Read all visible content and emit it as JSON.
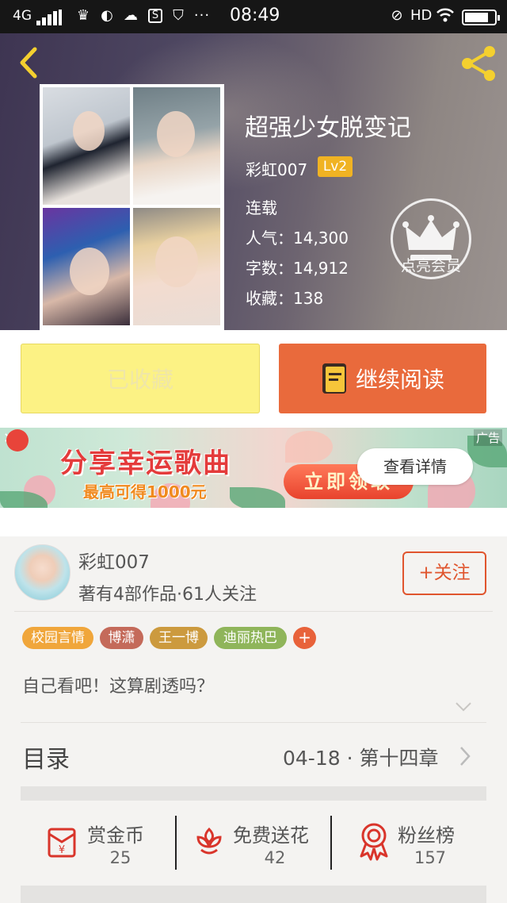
{
  "status_bar": {
    "network": "4G",
    "time": "08:49",
    "hd": "HD"
  },
  "book": {
    "title": "超强少女脱变记",
    "author": "彩虹007",
    "level": "Lv2",
    "status": "连载",
    "popularity_label": "人气：14,300",
    "words_label": "字数：14,912",
    "favorites_label": "收藏：138"
  },
  "vip": {
    "label": "点亮会员"
  },
  "actions": {
    "collected_label": "已收藏",
    "continue_label": "继续阅读"
  },
  "ad": {
    "title": "分享幸运歌曲",
    "subtitle": "最高可得1000元",
    "claim": "立即领取",
    "detail": "查看详情",
    "ad_tag": "广告",
    "close": "✕"
  },
  "author_card": {
    "name": "彩虹007",
    "stats": "著有4部作品·61人关注",
    "follow_label": "+关注"
  },
  "tags": [
    {
      "label": "校园言情",
      "color": "#f0a63b"
    },
    {
      "label": "博潇",
      "color": "#c46a5a"
    },
    {
      "label": "王一博",
      "color": "#cc9a3e"
    },
    {
      "label": "迪丽热巴",
      "color": "#8fb55a"
    }
  ],
  "tag_add": "+",
  "summary": "自己看吧！这算剧透吗？",
  "toc": {
    "label": "目录",
    "latest": "04-18 · 第十四章"
  },
  "stats": [
    {
      "label": "赏金币",
      "value": "25",
      "icon": "red-envelope-icon"
    },
    {
      "label": "免费送花",
      "value": "42",
      "icon": "flower-icon"
    },
    {
      "label": "粉丝榜",
      "value": "157",
      "icon": "medal-icon"
    }
  ],
  "colors": {
    "accent": "#e96a3c",
    "collected_bg": "#fcf284",
    "level_badge": "#f0b323",
    "icon_red": "#d9352b"
  }
}
